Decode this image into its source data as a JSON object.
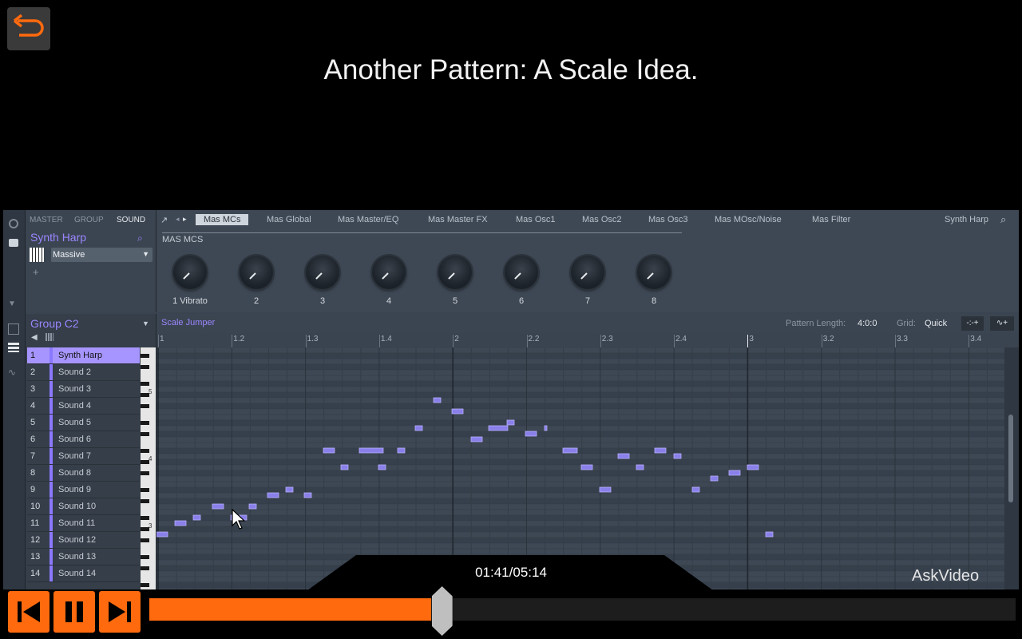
{
  "lesson_title": "Another Pattern:  A Scale Idea.",
  "sound_panel": {
    "tabs": [
      "MASTER",
      "GROUP",
      "SOUND"
    ],
    "active_tab": "SOUND",
    "sound_name": "Synth Harp",
    "plugin": "Massive",
    "add_label": "+"
  },
  "params": {
    "tabs": [
      "Mas MCs",
      "Mas Global",
      "Mas Master/EQ",
      "Mas Master FX",
      "Mas Osc1",
      "Mas Osc2",
      "Mas Osc3",
      "Mas MOsc/Noise",
      "Mas Filter"
    ],
    "active_tab": "Mas MCs",
    "right_label": "Synth Harp",
    "section_label": "MAS MCS",
    "knob_labels": [
      "1 Vibrato",
      "2",
      "3",
      "4",
      "5",
      "6",
      "7",
      "8"
    ]
  },
  "group": {
    "name": "Group C2",
    "sounds": [
      {
        "num": "1",
        "name": "Synth Harp"
      },
      {
        "num": "2",
        "name": "Sound 2"
      },
      {
        "num": "3",
        "name": "Sound 3"
      },
      {
        "num": "4",
        "name": "Sound 4"
      },
      {
        "num": "5",
        "name": "Sound 5"
      },
      {
        "num": "6",
        "name": "Sound 6"
      },
      {
        "num": "7",
        "name": "Sound 7"
      },
      {
        "num": "8",
        "name": "Sound 8"
      },
      {
        "num": "9",
        "name": "Sound 9"
      },
      {
        "num": "10",
        "name": "Sound 10"
      },
      {
        "num": "11",
        "name": "Sound 11"
      },
      {
        "num": "12",
        "name": "Sound 12"
      },
      {
        "num": "13",
        "name": "Sound 13"
      },
      {
        "num": "14",
        "name": "Sound 14"
      }
    ]
  },
  "editor": {
    "pattern_name": "Scale Jumper",
    "pattern_length_label": "Pattern Length:",
    "pattern_length": "4:0:0",
    "grid_label": "Grid:",
    "grid_value": "Quick",
    "ruler_marks": [
      "1",
      "1.2",
      "1.3",
      "1.4",
      "2",
      "2.2",
      "2.3",
      "2.4",
      "3",
      "3.2",
      "3.3",
      "3.4"
    ],
    "octave_labels": [
      "5",
      "4",
      "3"
    ],
    "accent_color": "#9b86ff",
    "note_color": "#8a80ea"
  },
  "player": {
    "time": "01:41/05:14",
    "progress": 0.325,
    "brand": "AskVideo",
    "accent_color": "#ff6a0e"
  }
}
